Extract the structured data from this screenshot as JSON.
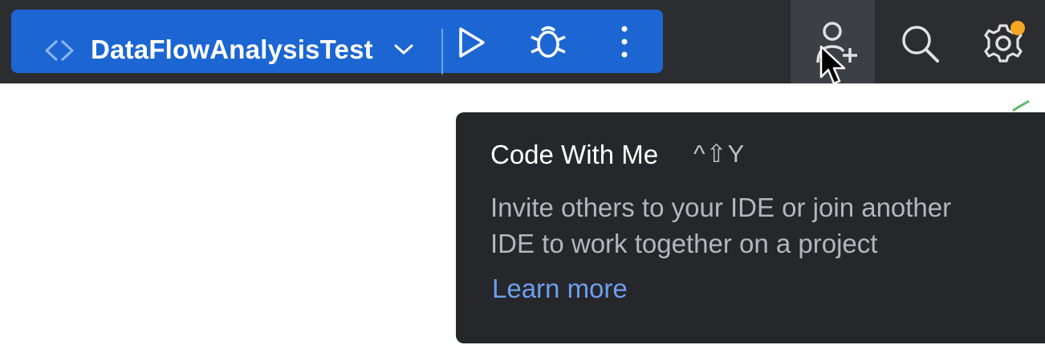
{
  "toolbar": {
    "run_config": {
      "name": "DataFlowAnalysisTest",
      "icon": "code-brackets-icon",
      "background": "#1c66d3"
    },
    "actions": [
      {
        "icon": "run-icon"
      },
      {
        "icon": "debug-icon"
      },
      {
        "icon": "more-vertical-icon"
      },
      {
        "icon": "code-with-me-icon"
      },
      {
        "icon": "search-icon"
      },
      {
        "icon": "settings-icon"
      }
    ],
    "notification_dot_color": "#f5a623"
  },
  "tooltip": {
    "title": "Code With Me",
    "shortcut": "^⇧Y",
    "description_line1": "Invite others to your IDE or join another",
    "description_line2": "IDE to work together on a project",
    "link": "Learn more"
  },
  "colors": {
    "toolbar_bg": "#2b2d30",
    "tooltip_bg": "#25272b",
    "link": "#6e9fed",
    "accent": "#1c66d3"
  }
}
